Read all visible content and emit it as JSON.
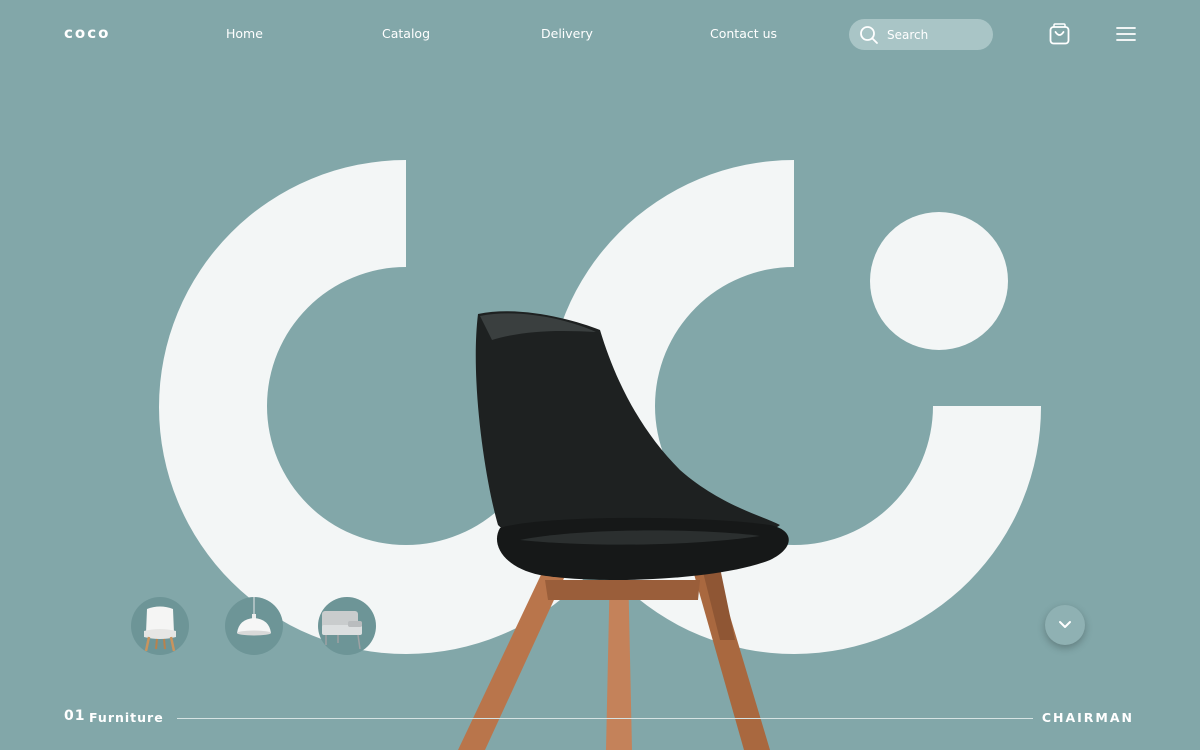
{
  "header": {
    "logo": "coco",
    "nav": [
      {
        "label": "Home"
      },
      {
        "label": "Catalog"
      },
      {
        "label": "Delivery"
      },
      {
        "label": "Contact us"
      }
    ],
    "search": {
      "placeholder": "Search",
      "icon": "search-icon"
    },
    "cart_icon": "shopping-bag-icon",
    "menu_icon": "hamburger-menu-icon"
  },
  "hero": {
    "product_image": "black-chair-wooden-legs",
    "thumbnails": [
      {
        "name": "white-chair"
      },
      {
        "name": "pendant-lamp"
      },
      {
        "name": "armchair"
      }
    ],
    "scroll_icon": "chevron-down-icon"
  },
  "footer": {
    "index": "01",
    "category": "Furniture",
    "product_name": "CHAIRMAN"
  },
  "colors": {
    "background": "#82a7a9",
    "shape": "#f3f6f6",
    "accent_dark": "#1e2121",
    "wood": "#b9754b"
  }
}
